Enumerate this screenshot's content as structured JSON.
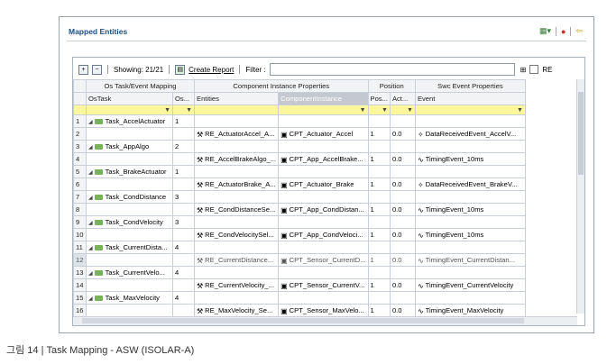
{
  "panel_title": "Mapped Entities",
  "toolbar": {
    "showing": "Showing: 21/21",
    "create_report": "Create Report",
    "filter_label": "Filter :",
    "filter_value": "",
    "re_label": "RE"
  },
  "groups": {
    "os_task": "Os Task/Event Mapping",
    "component": "Component Instance Properties",
    "position": "Position",
    "swc_event": "Swc Event Properties"
  },
  "columns": {
    "os_task": "OsTask",
    "os_short": "Os...",
    "entities": "Entities",
    "component_instance": "ComponentInstance",
    "pos": "Pos...",
    "act": "Act...",
    "event": "Event"
  },
  "rows": [
    {
      "n": "1",
      "task": "Task_AccelActuator",
      "os": "1",
      "entity": "",
      "comp": "",
      "pos": "",
      "act": "",
      "event": ""
    },
    {
      "n": "2",
      "task": "",
      "os": "",
      "entity": "RE_ActuatorAccel_A...",
      "comp": "CPT_Actuator_Accel",
      "pos": "1",
      "act": "0.0",
      "event": "DataReceivedEvent_AccelV..."
    },
    {
      "n": "3",
      "task": "Task_AppAlgo",
      "os": "2",
      "entity": "",
      "comp": "",
      "pos": "",
      "act": "",
      "event": ""
    },
    {
      "n": "4",
      "task": "",
      "os": "",
      "entity": "RE_AccelBrakeAlgo_...",
      "comp": "CPT_App_AccelBrake...",
      "pos": "1",
      "act": "0.0",
      "event": "TimingEvent_10ms"
    },
    {
      "n": "5",
      "task": "Task_BrakeActuator",
      "os": "1",
      "entity": "",
      "comp": "",
      "pos": "",
      "act": "",
      "event": ""
    },
    {
      "n": "6",
      "task": "",
      "os": "",
      "entity": "RE_ActuatorBrake_A...",
      "comp": "CPT_Actuator_Brake",
      "pos": "1",
      "act": "0.0",
      "event": "DataReceivedEvent_BrakeV..."
    },
    {
      "n": "7",
      "task": "Task_CondDistance",
      "os": "3",
      "entity": "",
      "comp": "",
      "pos": "",
      "act": "",
      "event": ""
    },
    {
      "n": "8",
      "task": "",
      "os": "",
      "entity": "RE_CondDistanceSe...",
      "comp": "CPT_App_CondDistan...",
      "pos": "1",
      "act": "0.0",
      "event": "TimingEvent_10ms"
    },
    {
      "n": "9",
      "task": "Task_CondVelocity",
      "os": "3",
      "entity": "",
      "comp": "",
      "pos": "",
      "act": "",
      "event": ""
    },
    {
      "n": "10",
      "task": "",
      "os": "",
      "entity": "RE_CondVelocitySel...",
      "comp": "CPT_App_CondVeloci...",
      "pos": "1",
      "act": "0.0",
      "event": "TimingEvent_10ms"
    },
    {
      "n": "11",
      "task": "Task_CurrentDista...",
      "os": "4",
      "entity": "",
      "comp": "",
      "pos": "",
      "act": "",
      "event": ""
    },
    {
      "n": "12",
      "task": "",
      "os": "",
      "entity": "RE_CurrentDistance...",
      "comp": "CPT_Sensor_CurrentD...",
      "pos": "1",
      "act": "0.0",
      "event": "TimingEvent_CurrentDistan..."
    },
    {
      "n": "13",
      "task": "Task_CurrentVelo...",
      "os": "4",
      "entity": "",
      "comp": "",
      "pos": "",
      "act": "",
      "event": ""
    },
    {
      "n": "14",
      "task": "",
      "os": "",
      "entity": "RE_CurrentVelocity_...",
      "comp": "CPT_Sensor_CurrentV...",
      "pos": "1",
      "act": "0.0",
      "event": "TimingEvent_CurrentVelocity"
    },
    {
      "n": "15",
      "task": "Task_MaxVelocity",
      "os": "4",
      "entity": "",
      "comp": "",
      "pos": "",
      "act": "",
      "event": ""
    },
    {
      "n": "16",
      "task": "",
      "os": "",
      "entity": "RE_MaxVelocity_Se...",
      "comp": "CPT_Sensor_MaxVelo...",
      "pos": "1",
      "act": "0.0",
      "event": "TimingEvent_MaxVelocity"
    }
  ],
  "caption": "그림 14 | Task Mapping - ASW (ISOLAR-A)"
}
